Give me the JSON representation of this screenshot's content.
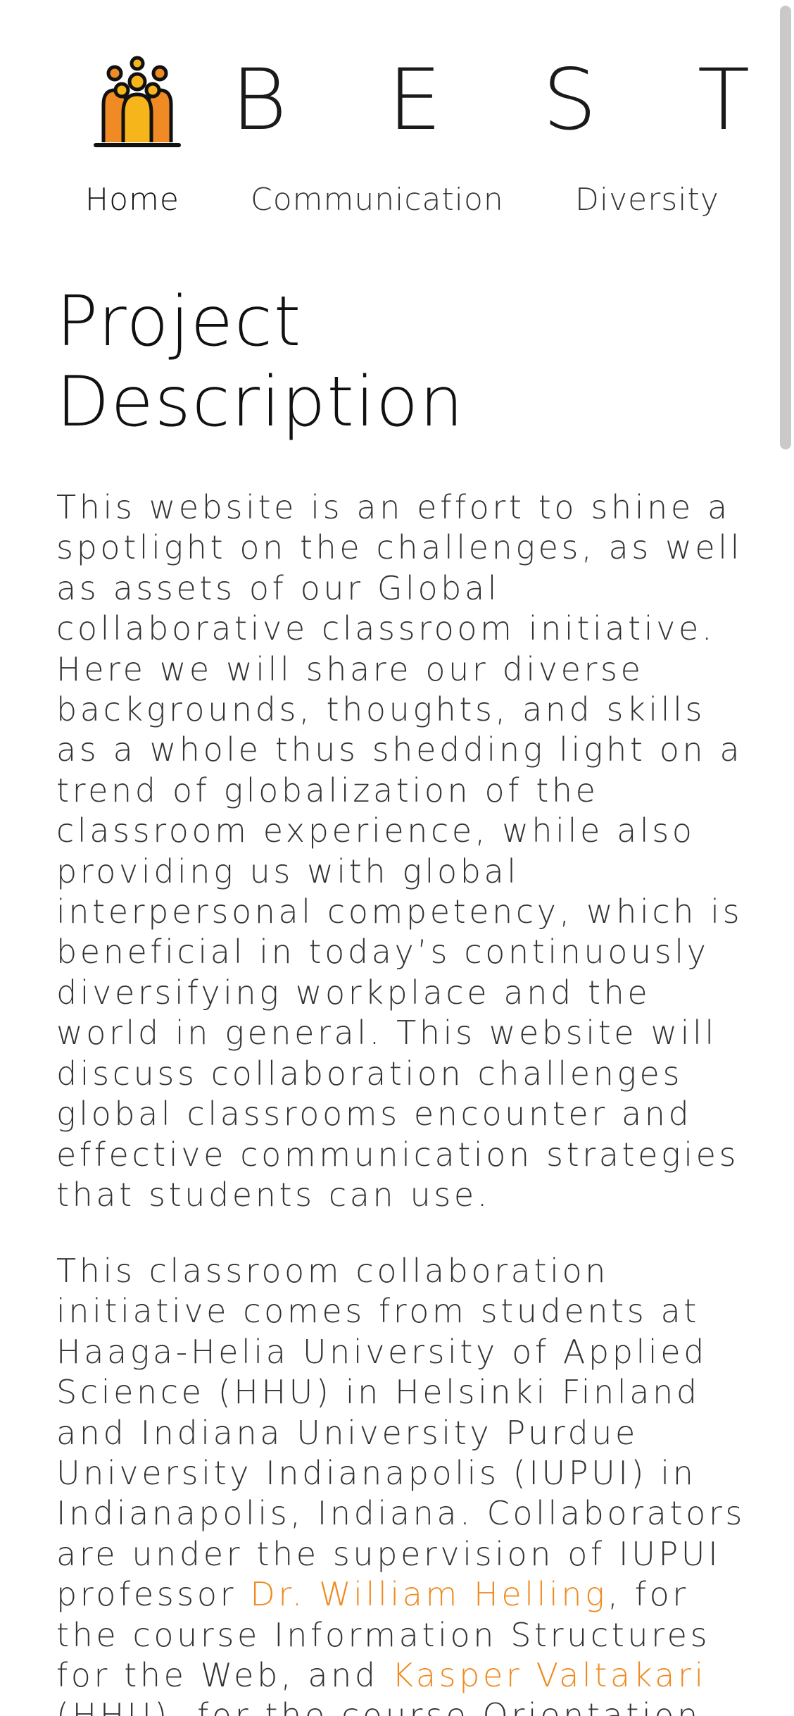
{
  "header": {
    "brand": "B E S T - G",
    "logo_icon": "people-group-icon",
    "nav": [
      {
        "label": "Home",
        "active": true
      },
      {
        "label": "Communication",
        "active": false
      },
      {
        "label": "Diversity",
        "active": false
      }
    ]
  },
  "main": {
    "title_line1": "Project",
    "title_line2": "Description",
    "paragraph1": "This website is an effort to shine a spotlight on the challenges, as well as assets of our Global collaborative classroom initiative. Here we will share our diverse backgrounds, thoughts, and skills as a whole thus shedding light on a trend of globalization of the classroom experience, while also providing us with global interpersonal competency, which is beneficial in today’s continuously diversifying workplace and the world in general. This website will discuss collaboration challenges global classrooms encounter and effective communication strategies that students can use.",
    "paragraph2_part1": "This classroom collaboration initiative comes from students at Haaga-Helia University of Applied Science (HHU) in Helsinki Finland and Indiana University Purdue University Indianapolis (IUPUI) in Indianapolis, Indiana. Collaborators are under the supervision of IUPUI professor ",
    "paragraph2_link1": "Dr. William Helling",
    "paragraph2_part2": ", for the course Information Structures for the Web, and ",
    "paragraph2_link2": "Kasper Valtakari",
    "paragraph2_part3": " (HHU), for the course Orientation"
  },
  "colors": {
    "accent": "#ef8a1f",
    "text": "#333333",
    "logo_yellow": "#f5b51b",
    "logo_orange": "#f08a24"
  }
}
